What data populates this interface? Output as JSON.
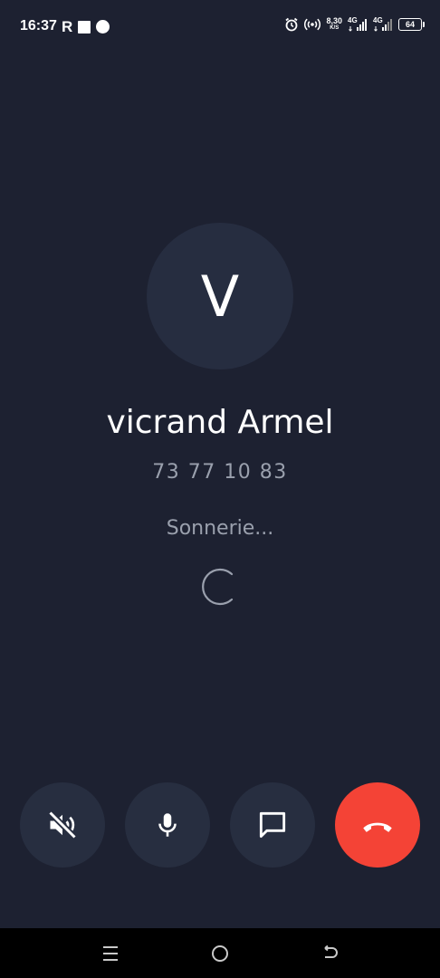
{
  "status_bar": {
    "time": "16:37",
    "r_glyph": "R",
    "net_speed": "8,30",
    "net_speed_unit": "K/S",
    "sim1_type": "4G",
    "sim2_type": "4G",
    "battery": "64",
    "icons": [
      "r-app-icon",
      "square-icon",
      "circle-icon",
      "alarm-icon",
      "hotspot-icon",
      "signal-icon",
      "battery-icon"
    ]
  },
  "caller": {
    "initial": "V",
    "name": "vicrand Armel",
    "number": "73 77 10 83",
    "status": "Sonnerie..."
  },
  "actions": [
    {
      "name": "speaker-off",
      "icon": "speaker-mute-icon"
    },
    {
      "name": "microphone",
      "icon": "microphone-icon"
    },
    {
      "name": "message",
      "icon": "chat-bubble-icon"
    },
    {
      "name": "hang-up",
      "icon": "phone-hangup-icon"
    }
  ],
  "nav_bar": {
    "icons": [
      "menu-icon",
      "home-icon",
      "back-icon"
    ]
  },
  "colors": {
    "background": "#1d2131",
    "button": "#272e40",
    "avatar": "#262d40",
    "hangup": "#f44336",
    "muted_text": "#9aa0ad"
  }
}
